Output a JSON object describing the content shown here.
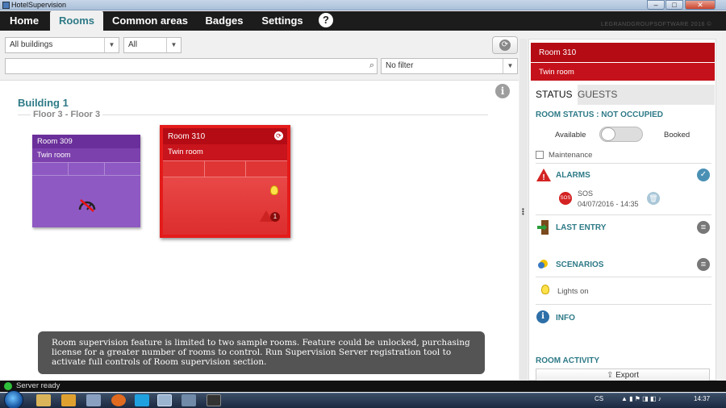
{
  "window": {
    "title": "HotelSupervision",
    "min_label": "–",
    "max_label": "□",
    "close_label": "✕"
  },
  "nav": {
    "tabs": [
      {
        "label": "Home",
        "active": false
      },
      {
        "label": "Rooms",
        "active": true
      },
      {
        "label": "Common areas",
        "active": false
      },
      {
        "label": "Badges",
        "active": false
      },
      {
        "label": "Settings",
        "active": false
      }
    ],
    "help_label": "?",
    "brand": "LEGRANDGROUPSOFTWARE 2016 ©"
  },
  "filters": {
    "building": "All buildings",
    "floor": "All",
    "search_value": "",
    "filter": "No filter"
  },
  "main": {
    "building_title": "Building 1",
    "floor_title": "Floor 3 - Floor 3",
    "rooms": [
      {
        "name": "Room 309",
        "type": "Twin room",
        "color": "#8e59c2"
      },
      {
        "name": "Room 310",
        "type": "Twin room",
        "color": "#e03535",
        "alarm_count": "1"
      }
    ],
    "notice": "Room supervision feature is limited to two sample rooms. Feature could be unlocked, purchasing license for a greater number of rooms to control. Run Supervision Server registration tool to activate full controls of Room supervision section."
  },
  "detail": {
    "room_name": "Room 310",
    "room_type": "Twin room",
    "tabs": [
      {
        "label": "STATUS",
        "active": true
      },
      {
        "label": "GUESTS",
        "active": false
      }
    ],
    "room_status": "ROOM STATUS : NOT OCCUPIED",
    "toggle_left": "Available",
    "toggle_right": "Booked",
    "maintenance_label": "Maintenance",
    "alarms_title": "ALARMS",
    "alarm": {
      "badge": "SOS",
      "label": "SOS",
      "time": "04/07/2016 - 14:35"
    },
    "last_entry_title": "LAST ENTRY",
    "scenarios_title": "SCENARIOS",
    "lights_label": "Lights on",
    "info_title": "INFO",
    "activity_title": "ROOM ACTIVITY",
    "export_label": "Export"
  },
  "status": {
    "text": "Server ready"
  },
  "taskbar": {
    "lang": "CS",
    "clock": "14:37"
  }
}
